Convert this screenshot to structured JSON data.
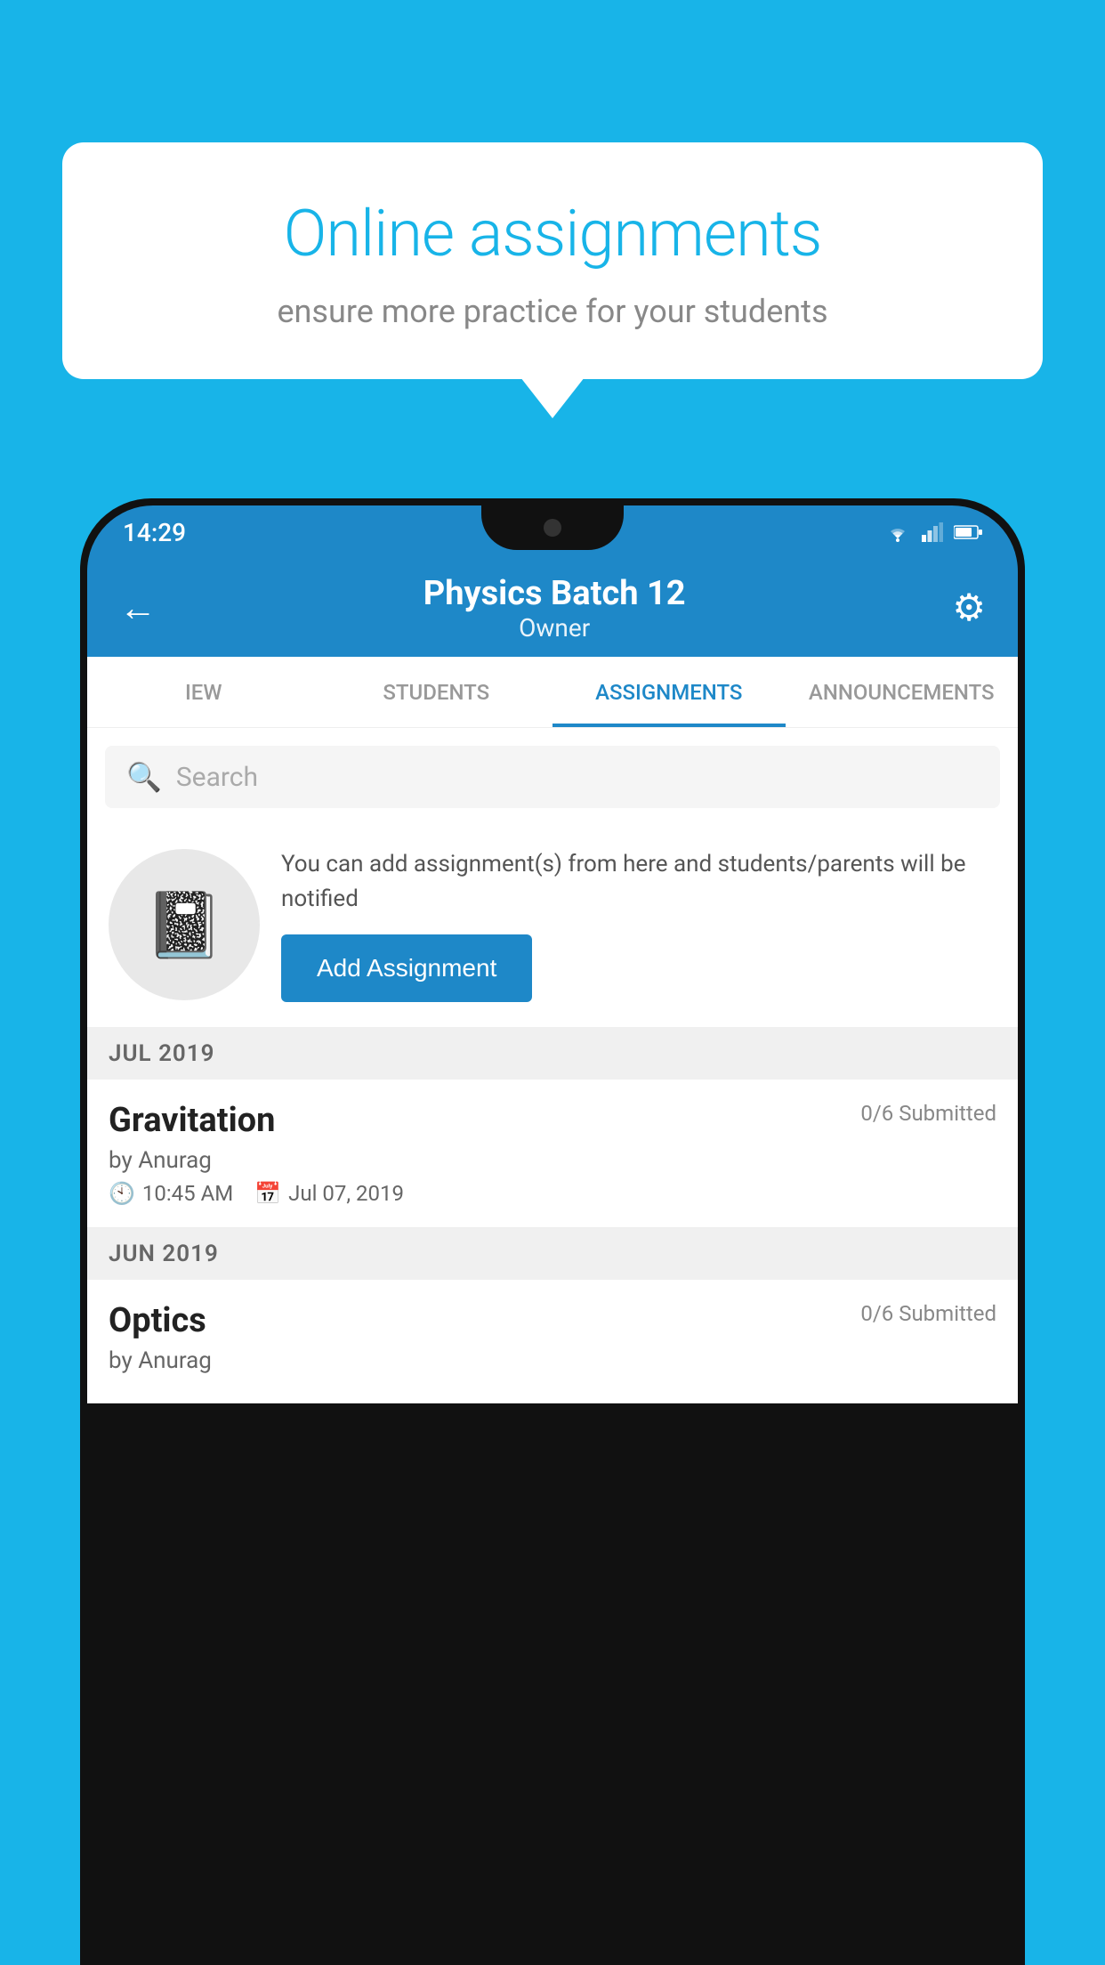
{
  "background_color": "#18B4E8",
  "speech_bubble": {
    "title": "Online assignments",
    "subtitle": "ensure more practice for your students"
  },
  "phone": {
    "status_bar": {
      "time": "14:29"
    },
    "app_bar": {
      "title": "Physics Batch 12",
      "subtitle": "Owner",
      "back_label": "←",
      "settings_label": "⚙"
    },
    "tabs": [
      {
        "label": "IEW",
        "active": false
      },
      {
        "label": "STUDENTS",
        "active": false
      },
      {
        "label": "ASSIGNMENTS",
        "active": true
      },
      {
        "label": "ANNOUNCEMENTS",
        "active": false
      }
    ],
    "search": {
      "placeholder": "Search"
    },
    "promo": {
      "text": "You can add assignment(s) from here and students/parents will be notified",
      "button_label": "Add Assignment"
    },
    "sections": [
      {
        "header": "JUL 2019",
        "assignments": [
          {
            "title": "Gravitation",
            "submitted": "0/6 Submitted",
            "author": "by Anurag",
            "time": "10:45 AM",
            "date": "Jul 07, 2019"
          }
        ]
      },
      {
        "header": "JUN 2019",
        "assignments": [
          {
            "title": "Optics",
            "submitted": "0/6 Submitted",
            "author": "by Anurag",
            "time": "",
            "date": ""
          }
        ]
      }
    ]
  }
}
